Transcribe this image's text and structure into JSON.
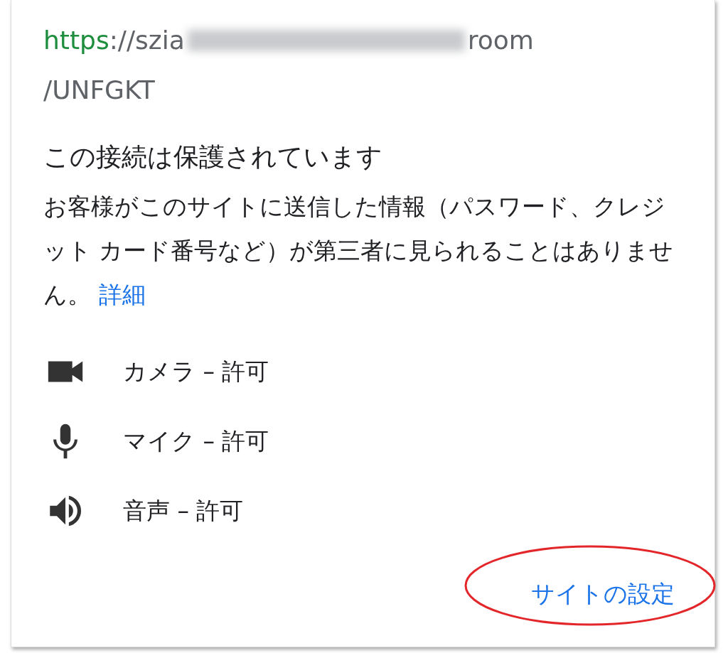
{
  "url": {
    "scheme": "https",
    "host_start": "://szia",
    "path_end": "room",
    "second_line": "/UNFGKT"
  },
  "heading": "この接続は保護されています",
  "description": "お客様がこのサイトに送信した情報（パスワード、クレジット カード番号など）が第三者に見られることはありません。",
  "details_link": "詳細",
  "permissions": [
    {
      "kind": "camera",
      "label": "カメラ – 許可"
    },
    {
      "kind": "microphone",
      "label": "マイク – 許可"
    },
    {
      "kind": "sound",
      "label": "音声 – 許可"
    }
  ],
  "site_settings_button": "サイトの設定"
}
